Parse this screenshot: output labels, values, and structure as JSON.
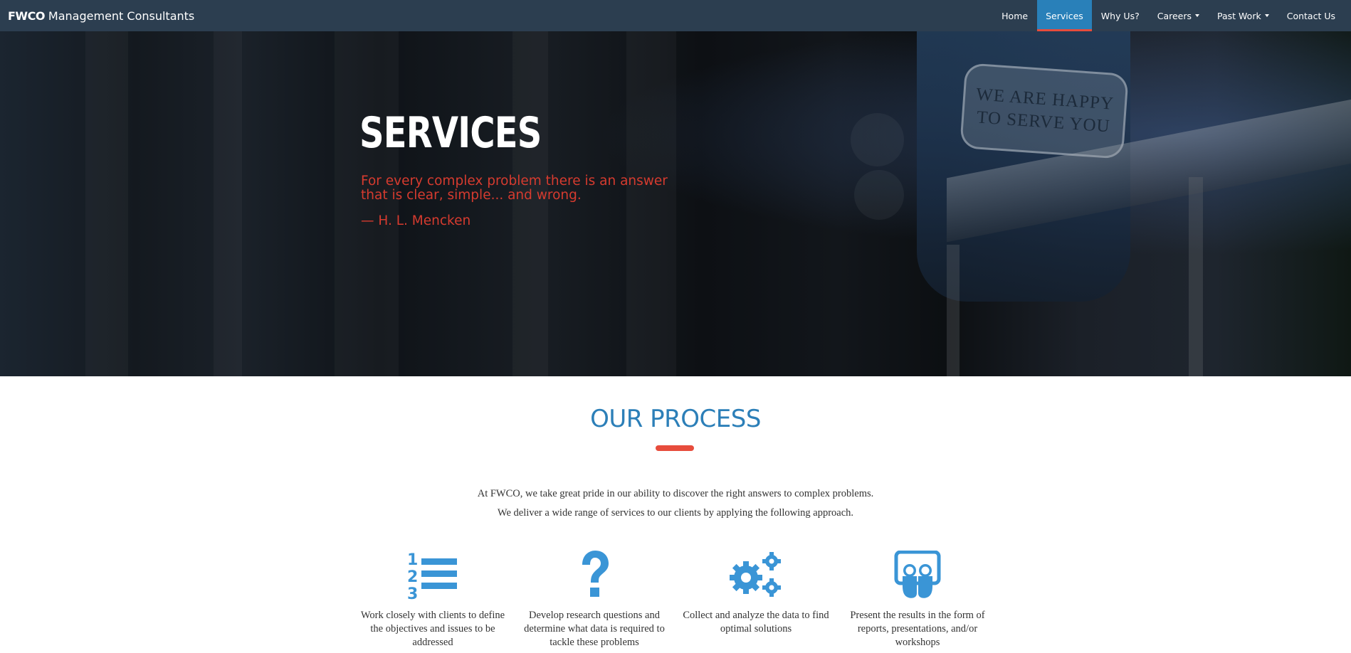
{
  "navbar": {
    "brand_strong": "FWCO",
    "brand_rest": "Management Consultants",
    "items": [
      {
        "label": "Home"
      },
      {
        "label": "Services",
        "active": true
      },
      {
        "label": "Why Us?"
      },
      {
        "label": "Careers",
        "dropdown": true
      },
      {
        "label": "Past Work",
        "dropdown": true
      },
      {
        "label": "Contact Us"
      }
    ]
  },
  "hero": {
    "title": "SERVICES",
    "quote": "For every complex problem there is an answer that is clear, simple... and wrong.",
    "author": "— H. L. Mencken",
    "cup_text_line1": "WE ARE HAPPY",
    "cup_text_line2": "TO SERVE YOU"
  },
  "process": {
    "title": "OUR PROCESS",
    "intro_line1": "At FWCO, we take great pride in our ability to discover the right answers to complex problems.",
    "intro_line2": "We deliver a wide range of services to our clients by applying the following approach.",
    "steps": [
      {
        "icon": "numbered-list-icon",
        "text": "Work closely with clients to define the objectives and issues to be addressed"
      },
      {
        "icon": "question-mark-icon",
        "text": "Develop research questions and determine what data is required to tackle these problems"
      },
      {
        "icon": "gears-icon",
        "text": "Collect and analyze the data to find optimal solutions"
      },
      {
        "icon": "presentation-icon",
        "text": "Present the results in the form of reports, presentations, and/or workshops"
      }
    ]
  },
  "colors": {
    "navbar_bg": "#2c3e50",
    "active_tab": "#2980b9",
    "accent_red": "#e74c3c",
    "heading_blue": "#2c7fb8",
    "icon_blue": "#3a95d6"
  }
}
